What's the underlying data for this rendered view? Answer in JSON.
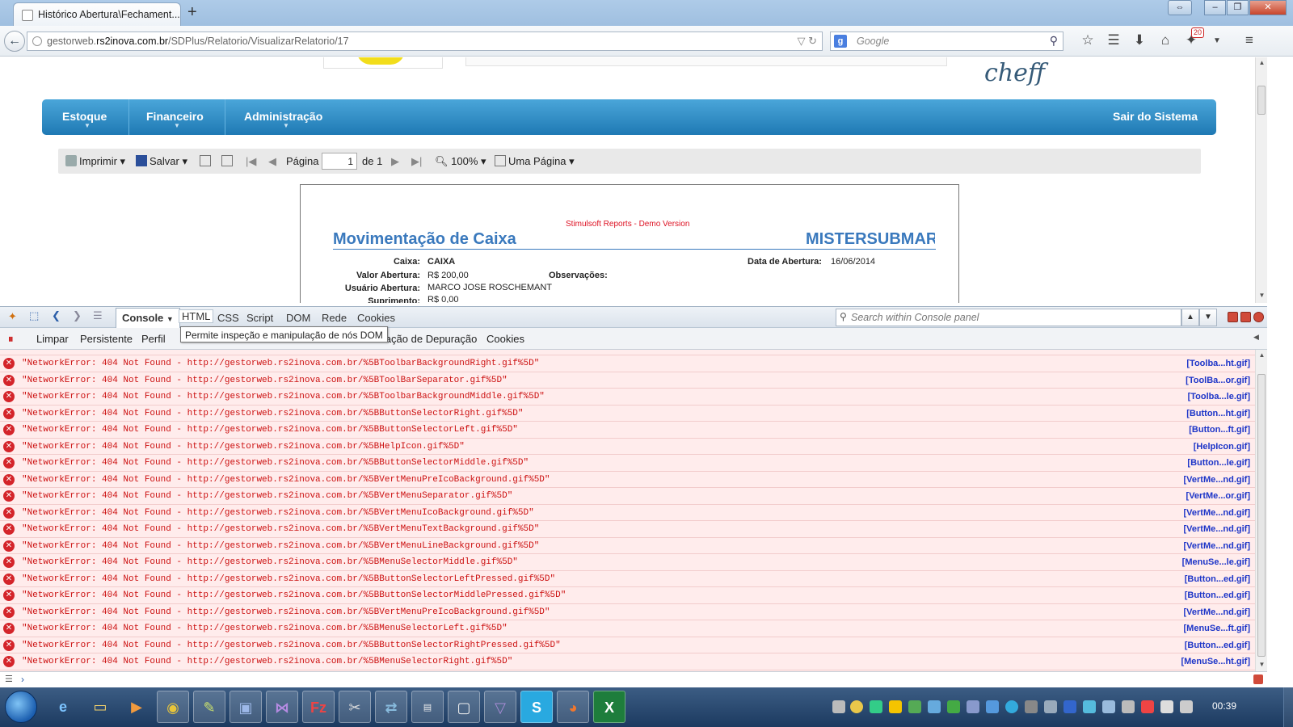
{
  "browser": {
    "tab_title": "Histórico Abertura\\Fechament...",
    "new_tab": "+",
    "url_prefix": "gestorweb.",
    "url_domain": "rs2inova.com.br",
    "url_path": "/SDPlus/Relatorio/VisualizarRelatorio/17",
    "search_placeholder": "Google",
    "downloads_badge": "20"
  },
  "site": {
    "logo_text": "cheff",
    "menu": [
      "Estoque",
      "Financeiro",
      "Administração"
    ],
    "logout": "Sair do Sistema"
  },
  "report_toolbar": {
    "print": "Imprimir",
    "save": "Salvar",
    "page_label": "Página",
    "page_value": "1",
    "of_label": "de 1",
    "zoom": "100%",
    "view": "Uma Página"
  },
  "report": {
    "demo_text": "Stimulsoft Reports - Demo Version",
    "title": "Movimentação de Caixa",
    "company": "MISTERSUBMARINE",
    "fields": [
      {
        "label": "Caixa:",
        "value": "CAIXA"
      },
      {
        "label": "Valor Abertura:",
        "value": "R$ 200,00"
      },
      {
        "label": "Usuário Abertura:",
        "value": "MARCO JOSE ROSCHEMANT"
      },
      {
        "label": "Suprimento:",
        "value": "R$ 0,00"
      }
    ],
    "open_date_label": "Data de Abertura:",
    "open_date_value": "16/06/2014",
    "notes_label": "Observações:"
  },
  "firebug": {
    "tabs": [
      "Console",
      "HTML",
      "CSS",
      "Script",
      "DOM",
      "Rede",
      "Cookies"
    ],
    "search_placeholder": "Search within Console panel",
    "toolbar": [
      "Limpar",
      "Persistente",
      "Perfil"
    ],
    "toolbar_right": [
      "mação de Depuração",
      "Cookies"
    ],
    "tooltip": "Permite inspeção e manipulação de nós DOM",
    "errors": [
      {
        "msg": "\"NetworkError: 404 Not Found - http://gestorweb.rs2inova.com.br/%5BToolbarBackgroundRight.gif%5D\"",
        "src": "[Toolba...ht.gif]"
      },
      {
        "msg": "\"NetworkError: 404 Not Found - http://gestorweb.rs2inova.com.br/%5BToolBarSeparator.gif%5D\"",
        "src": "[ToolBa...or.gif]"
      },
      {
        "msg": "\"NetworkError: 404 Not Found - http://gestorweb.rs2inova.com.br/%5BToolbarBackgroundMiddle.gif%5D\"",
        "src": "[Toolba...le.gif]"
      },
      {
        "msg": "\"NetworkError: 404 Not Found - http://gestorweb.rs2inova.com.br/%5BButtonSelectorRight.gif%5D\"",
        "src": "[Button...ht.gif]"
      },
      {
        "msg": "\"NetworkError: 404 Not Found - http://gestorweb.rs2inova.com.br/%5BButtonSelectorLeft.gif%5D\"",
        "src": "[Button...ft.gif]"
      },
      {
        "msg": "\"NetworkError: 404 Not Found - http://gestorweb.rs2inova.com.br/%5BHelpIcon.gif%5D\"",
        "src": "[HelpIcon.gif]"
      },
      {
        "msg": "\"NetworkError: 404 Not Found - http://gestorweb.rs2inova.com.br/%5BButtonSelectorMiddle.gif%5D\"",
        "src": "[Button...le.gif]"
      },
      {
        "msg": "\"NetworkError: 404 Not Found - http://gestorweb.rs2inova.com.br/%5BVertMenuPreIcoBackground.gif%5D\"",
        "src": "[VertMe...nd.gif]"
      },
      {
        "msg": "\"NetworkError: 404 Not Found - http://gestorweb.rs2inova.com.br/%5BVertMenuSeparator.gif%5D\"",
        "src": "[VertMe...or.gif]"
      },
      {
        "msg": "\"NetworkError: 404 Not Found - http://gestorweb.rs2inova.com.br/%5BVertMenuIcoBackground.gif%5D\"",
        "src": "[VertMe...nd.gif]"
      },
      {
        "msg": "\"NetworkError: 404 Not Found - http://gestorweb.rs2inova.com.br/%5BVertMenuTextBackground.gif%5D\"",
        "src": "[VertMe...nd.gif]"
      },
      {
        "msg": "\"NetworkError: 404 Not Found - http://gestorweb.rs2inova.com.br/%5BVertMenuLineBackground.gif%5D\"",
        "src": "[VertMe...nd.gif]"
      },
      {
        "msg": "\"NetworkError: 404 Not Found - http://gestorweb.rs2inova.com.br/%5BMenuSelectorMiddle.gif%5D\"",
        "src": "[MenuSe...le.gif]"
      },
      {
        "msg": "\"NetworkError: 404 Not Found - http://gestorweb.rs2inova.com.br/%5BButtonSelectorLeftPressed.gif%5D\"",
        "src": "[Button...ed.gif]"
      },
      {
        "msg": "\"NetworkError: 404 Not Found - http://gestorweb.rs2inova.com.br/%5BButtonSelectorMiddlePressed.gif%5D\"",
        "src": "[Button...ed.gif]"
      },
      {
        "msg": "\"NetworkError: 404 Not Found - http://gestorweb.rs2inova.com.br/%5BVertMenuPreIcoBackground.gif%5D\"",
        "src": "[VertMe...nd.gif]"
      },
      {
        "msg": "\"NetworkError: 404 Not Found - http://gestorweb.rs2inova.com.br/%5BMenuSelectorLeft.gif%5D\"",
        "src": "[MenuSe...ft.gif]"
      },
      {
        "msg": "\"NetworkError: 404 Not Found - http://gestorweb.rs2inova.com.br/%5BButtonSelectorRightPressed.gif%5D\"",
        "src": "[Button...ed.gif]"
      },
      {
        "msg": "\"NetworkError: 404 Not Found - http://gestorweb.rs2inova.com.br/%5BMenuSelectorRight.gif%5D\"",
        "src": "[MenuSe...ht.gif]"
      }
    ]
  },
  "taskbar": {
    "clock": "00:39"
  },
  "colors": {
    "menu_blue": "#1f79b4",
    "report_title": "#3a79bd",
    "error_red": "#cc1010",
    "error_bg": "#ffecec",
    "source_link": "#1d35c8"
  }
}
